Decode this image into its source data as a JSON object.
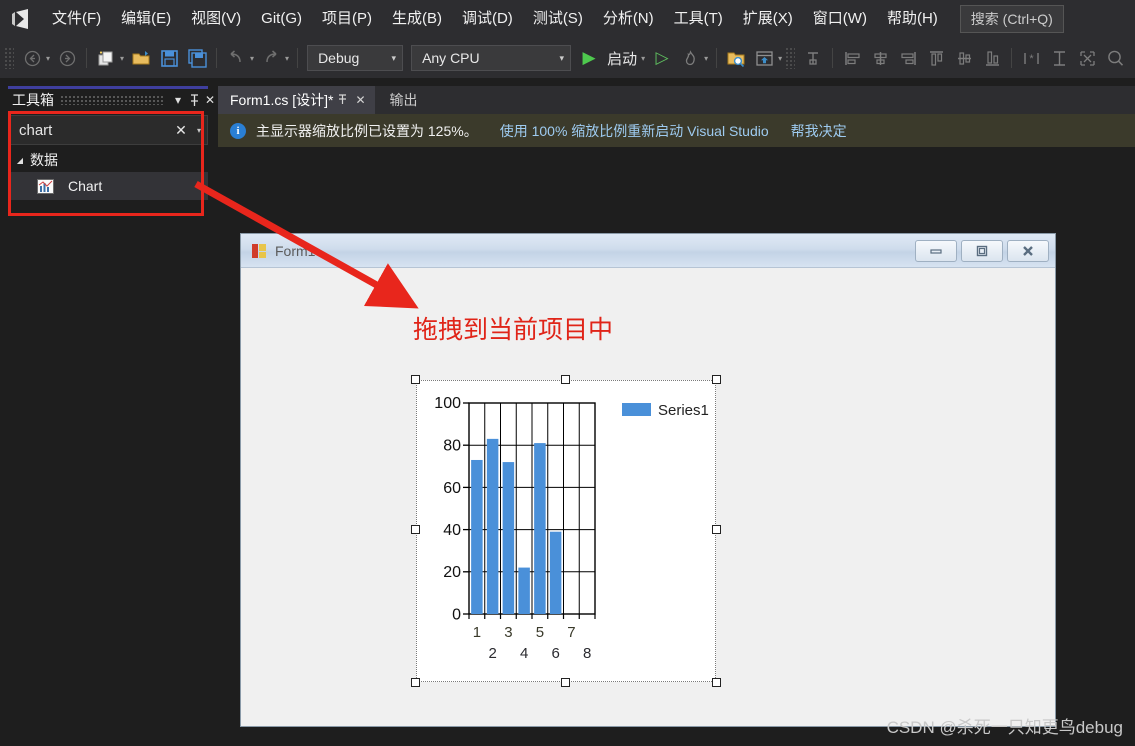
{
  "app": {
    "logo_icon": "visual-studio-logo",
    "menu_items": [
      {
        "label": "文件(F)"
      },
      {
        "label": "编辑(E)"
      },
      {
        "label": "视图(V)"
      },
      {
        "label": "Git(G)"
      },
      {
        "label": "项目(P)"
      },
      {
        "label": "生成(B)"
      },
      {
        "label": "调试(D)"
      },
      {
        "label": "测试(S)"
      },
      {
        "label": "分析(N)"
      },
      {
        "label": "工具(T)"
      },
      {
        "label": "扩展(X)"
      },
      {
        "label": "窗口(W)"
      },
      {
        "label": "帮助(H)"
      }
    ],
    "search_label": "搜索 (Ctrl+Q)"
  },
  "toolstrip": {
    "nav_back_icon": "arrow-back-circle-icon",
    "nav_forward_icon": "arrow-forward-circle-icon",
    "new_project_icon": "new-project-icon",
    "open_file_icon": "open-folder-icon",
    "save_icon": "save-icon",
    "save_all_icon": "save-all-icon",
    "undo_icon": "undo-icon",
    "redo_icon": "redo-icon",
    "config": "Debug",
    "platform": "Any CPU",
    "start_label": "启动",
    "start_icon": "play-icon",
    "start_no_debug_icon": "play-outline-icon",
    "hot_reload_icon": "flame-icon",
    "folder_search_icon": "folder-search-icon",
    "preview_icon": "preview-window-icon",
    "tab_order_icon": "tab-order-icon",
    "align_left_icon": "align-left-icon",
    "align_center_icon": "align-center-icon",
    "align_right_icon": "align-right-icon",
    "align_top_icon": "align-top-icon",
    "align_middle_icon": "align-middle-icon",
    "align_bottom_icon": "align-bottom-icon",
    "equal_width_icon": "make-same-width-icon",
    "equal_height_icon": "make-same-height-icon",
    "size_to_grid_icon": "size-to-grid-icon",
    "zoom_icon": "magnifier-icon"
  },
  "toolbox": {
    "title": "工具箱",
    "dropdown_icon": "chevron-down-icon",
    "pin_icon": "pin-icon",
    "close_icon": "close-icon",
    "search_value": "chart",
    "search_clear_icon": "clear-x-icon",
    "search_dropdown_icon": "chevron-down-icon",
    "category": {
      "label": "数据",
      "expand_icon": "triangle-down-icon",
      "items": [
        {
          "label": "Chart",
          "icon": "chart-control-icon",
          "selected": true
        }
      ]
    }
  },
  "editor": {
    "tabs": [
      {
        "label": "Form1.cs [设计]*",
        "active": true,
        "pin_icon": "pin-icon",
        "close_icon": "close-icon"
      },
      {
        "label": "输出",
        "active": false
      }
    ],
    "infobar": {
      "icon": "info-icon",
      "message": "主显示器缩放比例已设置为 125%。",
      "links": [
        {
          "label": "使用 100% 缩放比例重新启动 Visual Studio"
        },
        {
          "label": "帮我决定"
        }
      ]
    }
  },
  "form": {
    "icon": "form-designer-icon",
    "title": "Form1",
    "minimize_icon": "minimize-icon",
    "maximize_icon": "maximize-icon",
    "close_icon": "close-icon",
    "annotation_text": "拖拽到当前项目中"
  },
  "chart_data": {
    "type": "bar",
    "title": "",
    "categories": [
      "1",
      "2",
      "3",
      "4",
      "5",
      "6",
      "7",
      "8"
    ],
    "values": [
      73,
      83,
      72,
      22,
      81,
      39
    ],
    "series": [
      {
        "name": "Series1",
        "values": [
          73,
          83,
          72,
          22,
          81,
          39
        ],
        "color": "#4a90d9"
      }
    ],
    "legend": [
      "Series1"
    ],
    "legend_position": "top-right",
    "xlabel": "",
    "ylabel": "",
    "ylim": [
      0,
      100
    ],
    "yticks": [
      0,
      20,
      40,
      60,
      80,
      100
    ],
    "xticks": [
      "1",
      "2",
      "3",
      "4",
      "5",
      "6",
      "7",
      "8"
    ],
    "grid": true,
    "bar_color": "#4a90d9",
    "plot_border_color": "#000000",
    "background": "#ffffff"
  },
  "watermark": {
    "text": "CSDN @杀死一只知更鸟debug"
  }
}
